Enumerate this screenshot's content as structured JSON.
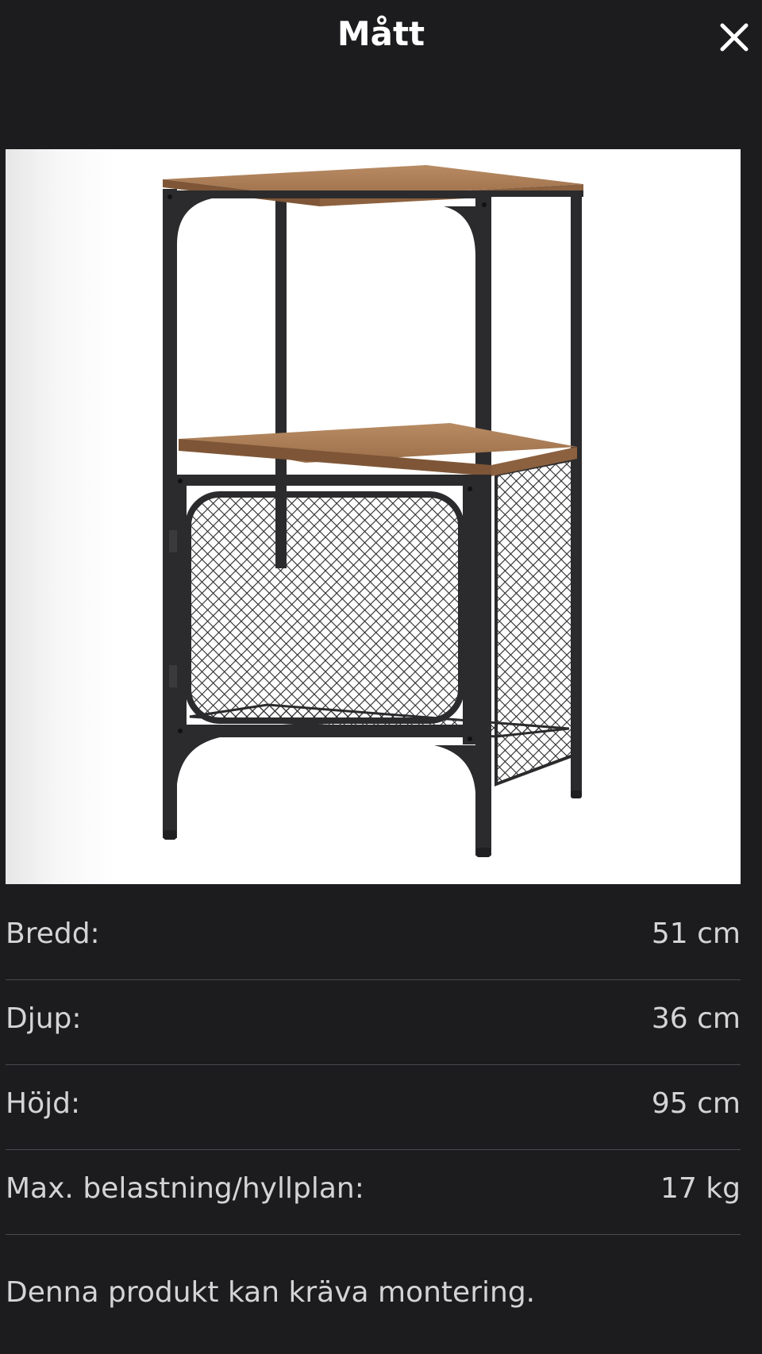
{
  "header": {
    "title": "Mått",
    "close_icon": "close-icon"
  },
  "product_image": {
    "icon": "shelf-unit-photo"
  },
  "dimensions": [
    {
      "label": "Bredd:",
      "value": "51 cm"
    },
    {
      "label": "Djup:",
      "value": "36 cm"
    },
    {
      "label": "Höjd:",
      "value": "95 cm"
    },
    {
      "label": "Max. belastning/hyllplan:",
      "value": "17 kg"
    }
  ],
  "note": "Denna produkt kan kräva montering.",
  "colors": {
    "background": "#1c1c1e",
    "text": "#d4d4d6",
    "divider": "#4a4a4e",
    "wood": "#a87a55",
    "metal": "#2b2b2d"
  }
}
